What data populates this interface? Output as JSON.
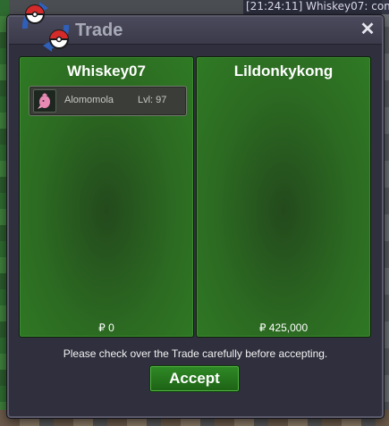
{
  "chat": {
    "line": "[21:24:11] Whiskey07: com"
  },
  "window": {
    "title": "Trade",
    "close_glyph": "✕"
  },
  "left_panel": {
    "player_name": "Whiskey07",
    "items": [
      {
        "name": "Alomomola",
        "level": "Lvl: 97",
        "icon": "pokemon-alomomola-icon"
      }
    ],
    "money": "₽ 0"
  },
  "right_panel": {
    "player_name": "Lildonkykong",
    "items": [],
    "money": "₽ 425,000"
  },
  "notice": "Please check over the Trade carefully before accepting.",
  "accept_label": "Accept",
  "colors": {
    "panel_green": "#2c6a22",
    "accept_green": "#2a7d20",
    "window_bg": "#2f2f3d",
    "title_text": "#a9aab8"
  }
}
